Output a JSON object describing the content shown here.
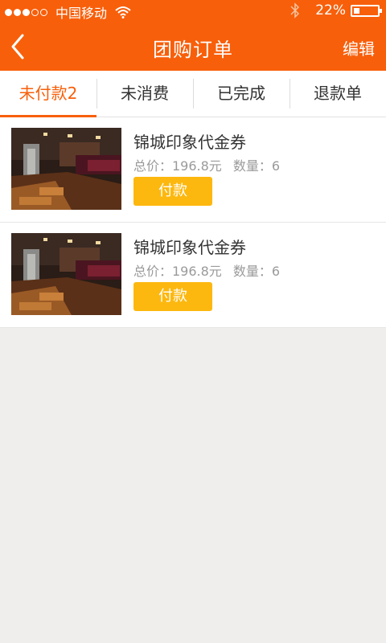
{
  "status_bar": {
    "carrier": "中国移动",
    "battery_percent": "22%",
    "signal_bars": 3,
    "signal_total": 5
  },
  "nav": {
    "back_icon": "chevron-left-icon",
    "title": "团购订单",
    "edit_label": "编辑"
  },
  "tabs": [
    {
      "label": "未付款2",
      "active": true
    },
    {
      "label": "未消费",
      "active": false
    },
    {
      "label": "已完成",
      "active": false
    },
    {
      "label": "退款单",
      "active": false
    }
  ],
  "orders": [
    {
      "name": "锦城印象代金券",
      "price_text": "总价：196.8元",
      "quantity_text": "数量：6",
      "pay_label": "付款"
    },
    {
      "name": "锦城印象代金券",
      "price_text": "总价：196.8元",
      "quantity_text": "数量：6",
      "pay_label": "付款"
    }
  ],
  "colors": {
    "accent": "#f85f0a",
    "pay_button": "#fdb80f",
    "background": "#efeeec"
  }
}
